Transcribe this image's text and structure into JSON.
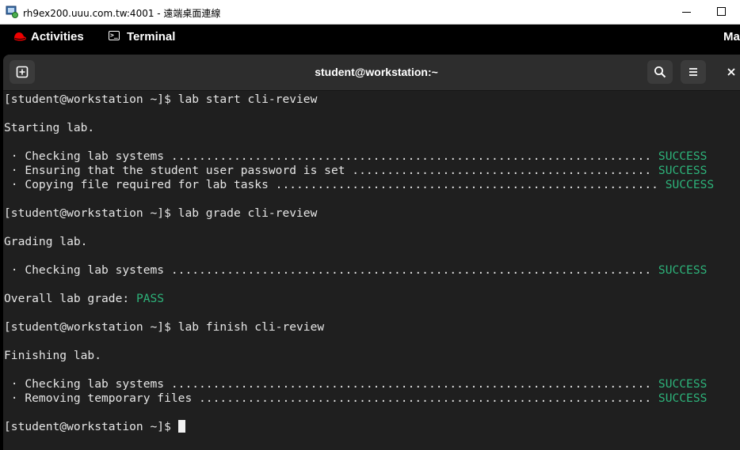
{
  "window": {
    "title": "rh9ex200.uuu.com.tw:4001 - 遠端桌面連線"
  },
  "gnome": {
    "activities": "Activities",
    "app_name": "Terminal",
    "clock": "Ma"
  },
  "terminal": {
    "title": "student@workstation:~",
    "lines": [
      {
        "text": "[student@workstation ~]$ lab start cli-review",
        "status": ""
      },
      {
        "text": "",
        "status": ""
      },
      {
        "text": "Starting lab.",
        "status": ""
      },
      {
        "text": "",
        "status": ""
      },
      {
        "text": " · Checking lab systems ..................................................................... ",
        "status": "SUCCESS"
      },
      {
        "text": " · Ensuring that the student user password is set ........................................... ",
        "status": "SUCCESS"
      },
      {
        "text": " · Copying file required for lab tasks ....................................................... ",
        "status": "SUCCESS"
      },
      {
        "text": "",
        "status": ""
      },
      {
        "text": "[student@workstation ~]$ lab grade cli-review",
        "status": ""
      },
      {
        "text": "",
        "status": ""
      },
      {
        "text": "Grading lab.",
        "status": ""
      },
      {
        "text": "",
        "status": ""
      },
      {
        "text": " · Checking lab systems ..................................................................... ",
        "status": "SUCCESS"
      },
      {
        "text": "",
        "status": ""
      },
      {
        "text": "Overall lab grade: ",
        "status": "PASS"
      },
      {
        "text": "",
        "status": ""
      },
      {
        "text": "[student@workstation ~]$ lab finish cli-review",
        "status": ""
      },
      {
        "text": "",
        "status": ""
      },
      {
        "text": "Finishing lab.",
        "status": ""
      },
      {
        "text": "",
        "status": ""
      },
      {
        "text": " · Checking lab systems ..................................................................... ",
        "status": "SUCCESS"
      },
      {
        "text": " · Removing temporary files ................................................................. ",
        "status": "SUCCESS"
      },
      {
        "text": "",
        "status": ""
      }
    ],
    "prompt": "[student@workstation ~]$ "
  },
  "colors": {
    "success": "#2db37a",
    "background": "#1f1f1f",
    "foreground": "#e6e6e6"
  },
  "icons": {
    "app_icon": "remote-desktop-icon",
    "logo": "redhat-logo-icon",
    "new_tab": "new-tab-icon",
    "search": "search-icon",
    "menu": "hamburger-menu-icon",
    "close": "close-icon"
  }
}
